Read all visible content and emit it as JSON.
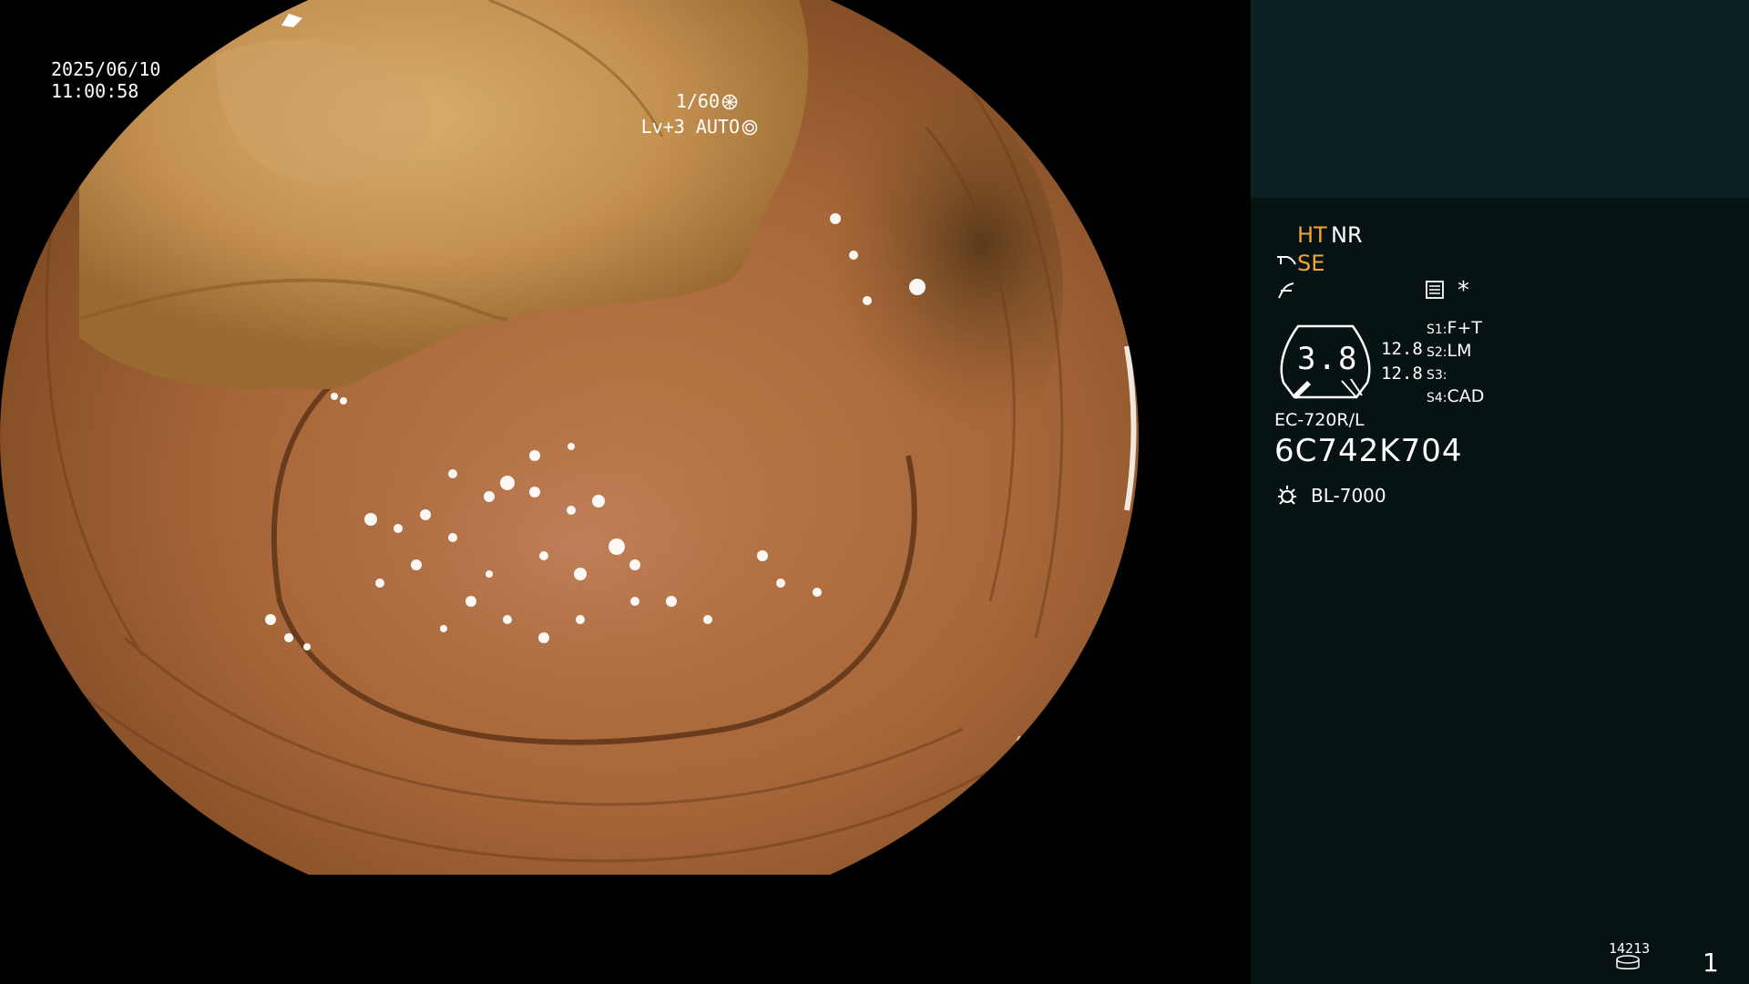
{
  "video_osd": {
    "date": "2025/06/10",
    "time": "11:00:58",
    "shutter": "1/60",
    "shutter_icon": "shutter-icon",
    "level": "Lv+3 AUTO",
    "level_icon": "iris-auto-icon"
  },
  "panel": {
    "modes": {
      "ht": "HT",
      "nr": "NR",
      "se": "SE",
      "se_icon": "scope-enhance-icon",
      "enhance_icon": "enhancement-icon",
      "doc_icon": "document-icon",
      "star": "*"
    },
    "zoom": {
      "value": "3.8",
      "focal_1": "12.8",
      "focal_2": "12.8"
    },
    "slots": {
      "s1_key": "S1:",
      "s1_val": "F+T",
      "s2_key": "S2:",
      "s2_val": "LM",
      "s3_key": "S3:",
      "s3_val": "",
      "s4_key": "S4:",
      "s4_val": "CAD"
    },
    "scope": {
      "model": "EC-720R/L",
      "serial": "6C742K704"
    },
    "light": {
      "icon": "light-source-icon",
      "model": "BL-7000"
    },
    "footer": {
      "counter": "14213",
      "disk_icon": "storage-disk-icon",
      "page": "1"
    }
  },
  "colors": {
    "panel_bg": "#071214",
    "panel_top_bg": "#0c2124",
    "amber": "#f0a830",
    "mucosa": "#b0703a",
    "residue": "#c89a5a"
  }
}
